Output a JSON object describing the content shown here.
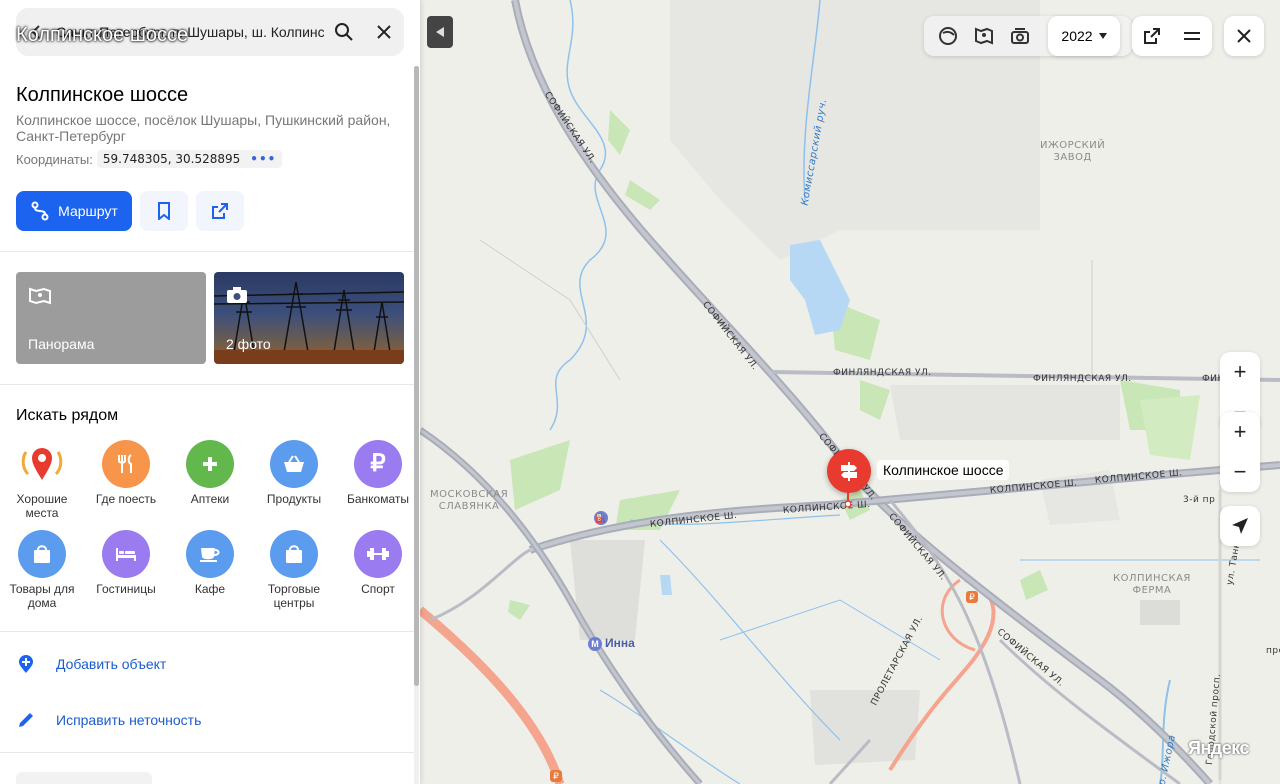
{
  "search": {
    "value": "Санкт-Петербург, п. Шушары, ш. Колпинское"
  },
  "overlay_title": "Колпинское шоссе",
  "place": {
    "title": "Колпинское шоссе",
    "address": "Колпинское шоссе, посёлок Шушары, Пушкинский район, Санкт-Петербург",
    "coords_label": "Координаты:",
    "coords_value": "59.748305, 30.528895",
    "coords_more": "•••"
  },
  "actions": {
    "route_label": "Маршрут"
  },
  "media": {
    "panorama_label": "Панорама",
    "photos_label": "2 фото"
  },
  "nearby": {
    "title": "Искать рядом",
    "categories": [
      {
        "label": "Хорошие места",
        "color": "#ffffff",
        "icon": "pin-laurel-icon"
      },
      {
        "label": "Где поесть",
        "color": "#f7954a",
        "icon": "fork-knife-icon"
      },
      {
        "label": "Аптеки",
        "color": "#62b84c",
        "icon": "plus-icon"
      },
      {
        "label": "Продукты",
        "color": "#5b9cee",
        "icon": "basket-icon"
      },
      {
        "label": "Банкоматы",
        "color": "#9a7bf0",
        "icon": "ruble-icon"
      },
      {
        "label": "Товары для дома",
        "color": "#5b9cee",
        "icon": "bag-icon"
      },
      {
        "label": "Гостиницы",
        "color": "#9a7bf0",
        "icon": "bed-icon"
      },
      {
        "label": "Кафе",
        "color": "#5b9cee",
        "icon": "cup-icon"
      },
      {
        "label": "Торговые центры",
        "color": "#5b9cee",
        "icon": "bag-icon"
      },
      {
        "label": "Спорт",
        "color": "#9a7bf0",
        "icon": "dumbbell-icon"
      }
    ]
  },
  "links": {
    "add_object": "Добавить объект",
    "fix_error": "Исправить неточность"
  },
  "map": {
    "year": "2022",
    "pin_label": "Колпинское шоссе",
    "logo": "Яндекс",
    "metro_label": "Инна",
    "zoom_in": "+",
    "zoom_out": "−",
    "labels": {
      "sofiyskaya_1": "Софийская ул.",
      "sofiyskaya_2": "Софийская ул.",
      "sofiyskaya_3": "Софийская ул.",
      "sofiyskaya_4": "Софийская ул.",
      "sofiyskaya_5": "Софийская ул.",
      "finlyandskaya_1": "Финляндская ул.",
      "finlyandskaya_2": "Финляндская ул.",
      "finlyandskaya_3": "Финл",
      "kolpinskoe_1": "Колпинское ш.",
      "kolpinskoe_2": "Колпинское ш.",
      "kolpinskoe_3": "Колпинское ш.",
      "kolpinskoe_4": "Колпинское ш.",
      "proletarskaya": "Пролетарская ул.",
      "izhorsky": "Ижорский\nзавод",
      "moskovskaya": "Московская\nСлавянка",
      "kolpinskaya_ferma": "Колпинская\nферма",
      "tretiy": "3-й пр",
      "tankist": "ул. Танкист",
      "komissarsky": "Комиссарский руч.",
      "izhora": "р. Ижора",
      "gorodskoy": "Городской просп.",
      "pro": "про"
    }
  }
}
